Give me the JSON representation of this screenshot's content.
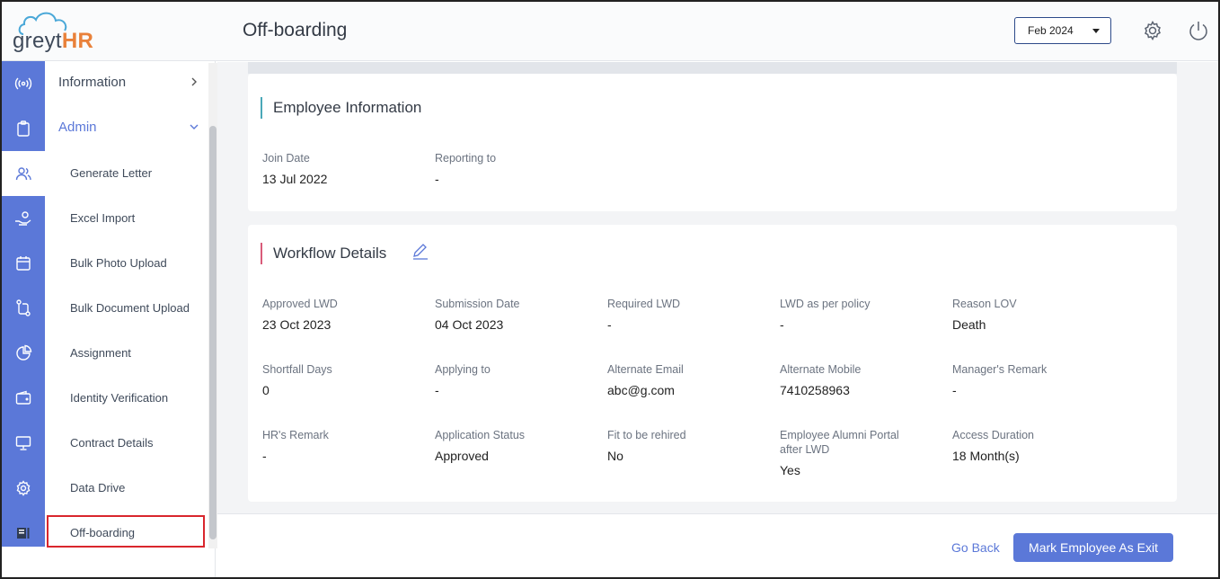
{
  "app": {
    "logo_text": "greyt",
    "logo_accent": "HR",
    "page_title": "Off-boarding"
  },
  "header": {
    "month": "Feb 2024",
    "icons": [
      "gear-icon",
      "power-icon"
    ]
  },
  "rail": [
    "broadcast-icon",
    "clipboard-icon",
    "users-icon",
    "hand-coin-icon",
    "calendar-icon",
    "workflow-icon",
    "pie-chart-icon",
    "wallet-icon",
    "monitor-icon",
    "settings-cog-icon",
    "report-icon"
  ],
  "menu": {
    "information": "Information",
    "admin": "Admin",
    "items": [
      "Generate Letter",
      "Excel Import",
      "Bulk Photo Upload",
      "Bulk Document Upload",
      "Assignment",
      "Identity Verification",
      "Contract Details",
      "Data Drive",
      "Off-boarding"
    ]
  },
  "employee_info": {
    "title": "Employee Information",
    "fields": [
      {
        "label": "Join Date",
        "value": "13 Jul 2022"
      },
      {
        "label": "Reporting to",
        "value": "-"
      }
    ]
  },
  "workflow": {
    "title": "Workflow Details",
    "fields": [
      {
        "label": "Approved LWD",
        "value": "23 Oct 2023"
      },
      {
        "label": "Submission Date",
        "value": "04 Oct 2023"
      },
      {
        "label": "Required LWD",
        "value": "-"
      },
      {
        "label": "LWD as per policy",
        "value": "-"
      },
      {
        "label": "Reason LOV",
        "value": "Death"
      },
      {
        "label": "Shortfall Days",
        "value": "0"
      },
      {
        "label": "Applying to",
        "value": "-"
      },
      {
        "label": "Alternate Email",
        "value": "abc@g.com"
      },
      {
        "label": "Alternate Mobile",
        "value": "7410258963"
      },
      {
        "label": "Manager's Remark",
        "value": "-"
      },
      {
        "label": "HR's Remark",
        "value": "-"
      },
      {
        "label": "Application Status",
        "value": "Approved"
      },
      {
        "label": "Fit to be rehired",
        "value": "No"
      },
      {
        "label": "Employee Alumni Portal after LWD",
        "value": "Yes"
      },
      {
        "label": "Access Duration",
        "value": "18 Month(s)"
      }
    ]
  },
  "footer": {
    "go_back": "Go Back",
    "mark_exit": "Mark Employee As Exit"
  },
  "colors": {
    "primary": "#5b78d8",
    "accent_orange": "#e9813a",
    "highlight_red": "#d9262d"
  }
}
